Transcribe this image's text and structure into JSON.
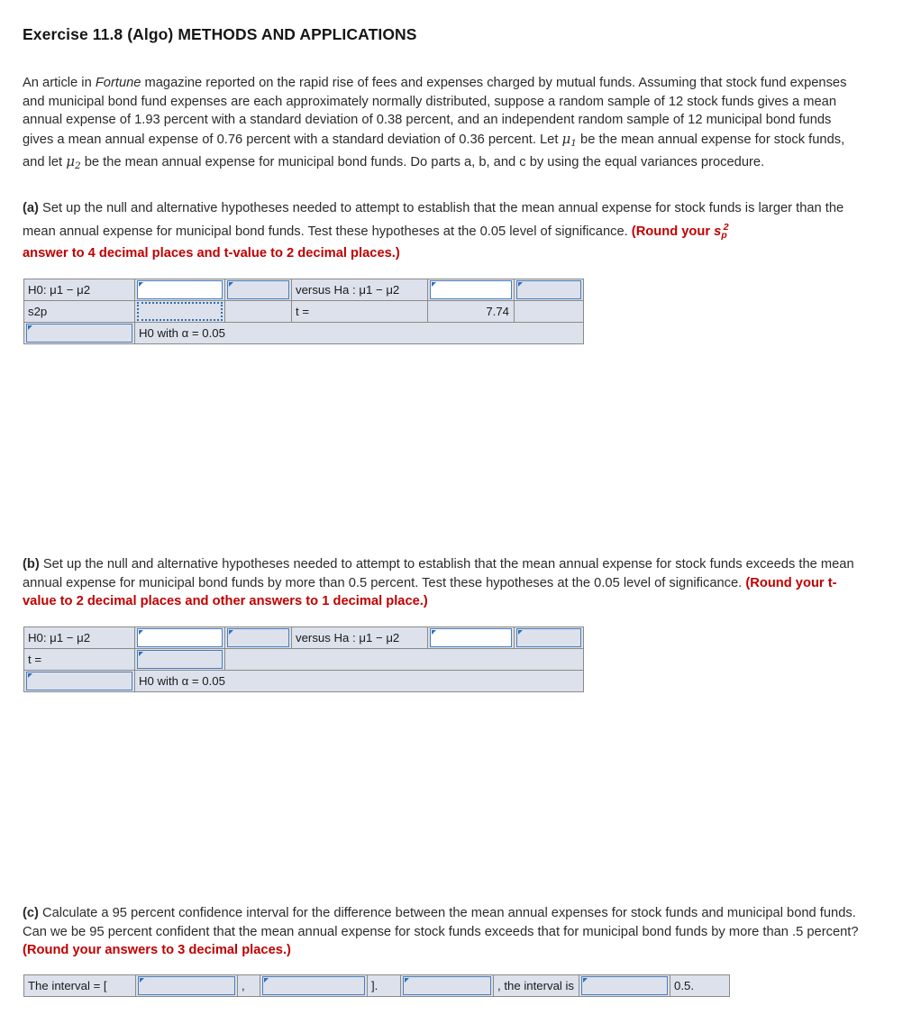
{
  "header": {
    "title": "Exercise 11.8 (Algo) METHODS AND APPLICATIONS"
  },
  "intro": {
    "p1_a": "An article in ",
    "p1_italic": "Fortune",
    "p1_b": " magazine reported on the rapid rise of fees and expenses charged by mutual funds. Assuming that stock fund expenses and municipal bond fund expenses are each approximately normally distributed, suppose a random sample of 12 stock funds gives a mean annual expense of 1.93 percent with a standard deviation of 0.38 percent, and an independent random sample of 12 municipal bond funds gives a mean annual expense of 0.76 percent with a standard deviation of 0.36 percent. Let ",
    "mu1": "μ",
    "mu1_sub": "1",
    "p1_c": " be the mean annual expense for stock funds, and let ",
    "mu2": "μ",
    "mu2_sub": "2",
    "p1_d": " be the mean annual expense for municipal bond funds. Do parts a, b, and c by using the equal variances procedure."
  },
  "part_a": {
    "label": "(a)",
    "text": " Set up the null and alternative hypotheses needed to attempt to establish that the mean annual expense for stock funds is larger than the mean annual expense for municipal bond funds. Test these hypotheses at the 0.05 level of significance. ",
    "round_note_open": "(Round your ",
    "sp_s": "s",
    "sp_p": "p",
    "sp_sq": "2",
    "round_note_close": "answer to 4 decimal places and t-value to 2 decimal places.)",
    "table": {
      "row1": {
        "label": "H0: μ1 − μ2",
        "input1_value": "",
        "select1_value": "",
        "label2": "versus Ha : μ1 − μ2",
        "input2_value": "",
        "select2_value": ""
      },
      "row2": {
        "label": "s2p",
        "input_value": "",
        "filler": "",
        "label2": "t =",
        "t_value": "7.74",
        "trailing": ""
      },
      "row3": {
        "select_value": "",
        "label": "H0 with α = 0.05"
      }
    }
  },
  "part_b": {
    "label": "(b)",
    "text": " Set up the null and alternative hypotheses needed to attempt to establish that the mean annual expense for stock funds exceeds the mean annual expense for municipal bond funds by more than 0.5 percent. Test these hypotheses at the 0.05 level of significance. ",
    "round_note": "(Round your t-value to 2 decimal places and other answers to 1 decimal place.)",
    "table": {
      "row1": {
        "label": "H0: μ1 − μ2",
        "input1_value": "",
        "select1_value": "",
        "label2": "versus Ha : μ1 − μ2",
        "input2_value": "",
        "select2_value": ""
      },
      "row2": {
        "label": "t =",
        "input_value": "",
        "filler": ""
      },
      "row3": {
        "select_value": "",
        "label": "H0 with α = 0.05"
      }
    }
  },
  "part_c": {
    "label": "(c)",
    "text": " Calculate a 95 percent confidence interval for the difference between the mean annual expenses for stock funds and municipal bond funds. Can we be 95 percent confident that the mean annual expense for stock funds exceeds that for municipal bond funds by more than .5 percent? ",
    "round_note": "(Round your answers to 3 decimal places.)",
    "table": {
      "label_open": "The interval = [",
      "input1_value": "",
      "comma": ",",
      "input2_value": "",
      "bracket_close": "].",
      "select1_value": "",
      "label_mid": ", the interval is",
      "select2_value": "",
      "label_end": "0.5."
    }
  },
  "colors": {
    "cell_fill": "#dce1eb",
    "cell_border": "#8a8a8a",
    "control_border": "#4a7ebb",
    "flag": "#2f6fb5",
    "red_note": "#c00000"
  }
}
